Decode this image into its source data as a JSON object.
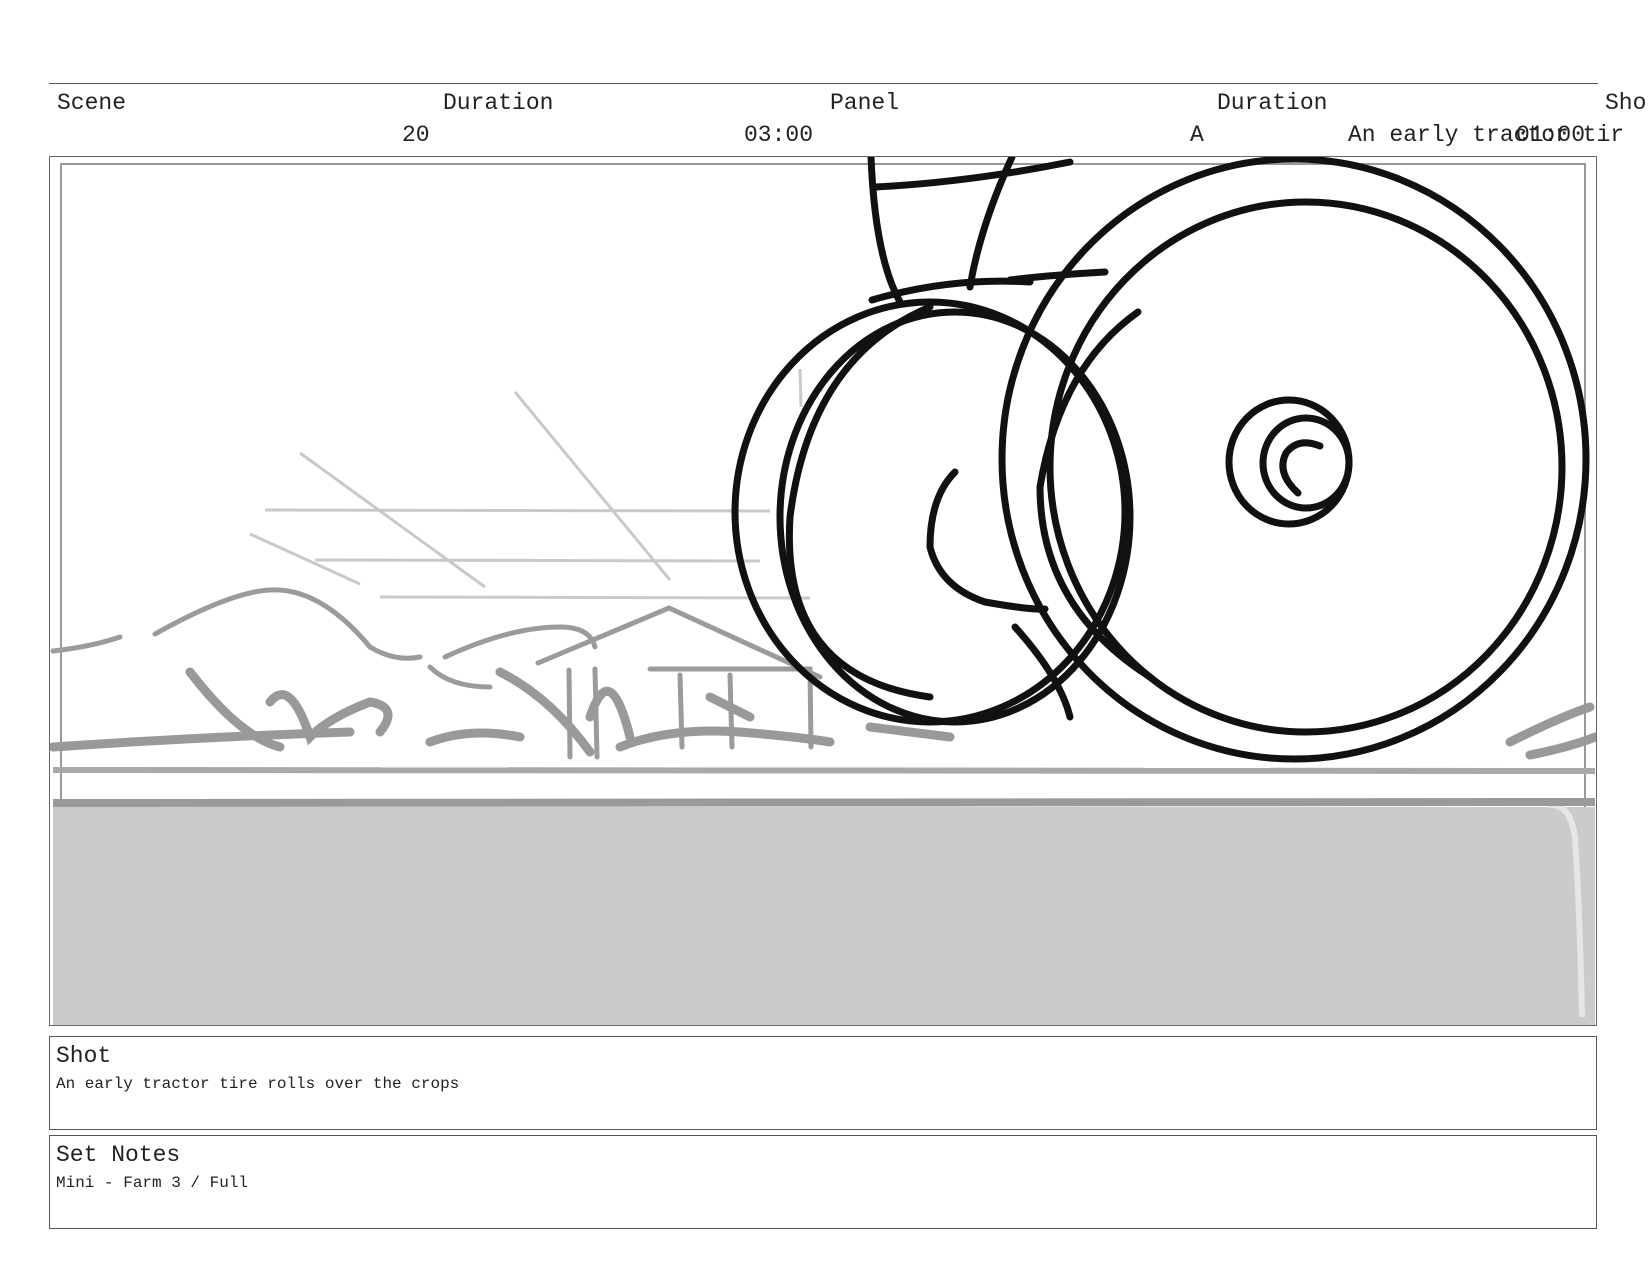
{
  "header": {
    "scene_label": "Scene",
    "scene_duration_label": "Duration",
    "panel_label": "Panel",
    "panel_duration_label": "Duration",
    "shot_label": "Sho",
    "scene_value": "20",
    "scene_duration_value": "03:00",
    "panel_value": "A",
    "shot_value": "An early tractor tir",
    "panel_duration_value": "01:00"
  },
  "panel": {
    "image_description_icon": "storyboard-sketch-tractor-tire"
  },
  "shot_box": {
    "title": "Shot",
    "text": "An early tractor tire rolls over the crops"
  },
  "set_notes_box": {
    "title": "Set Notes",
    "text": "Mini - Farm 3 / Full"
  }
}
